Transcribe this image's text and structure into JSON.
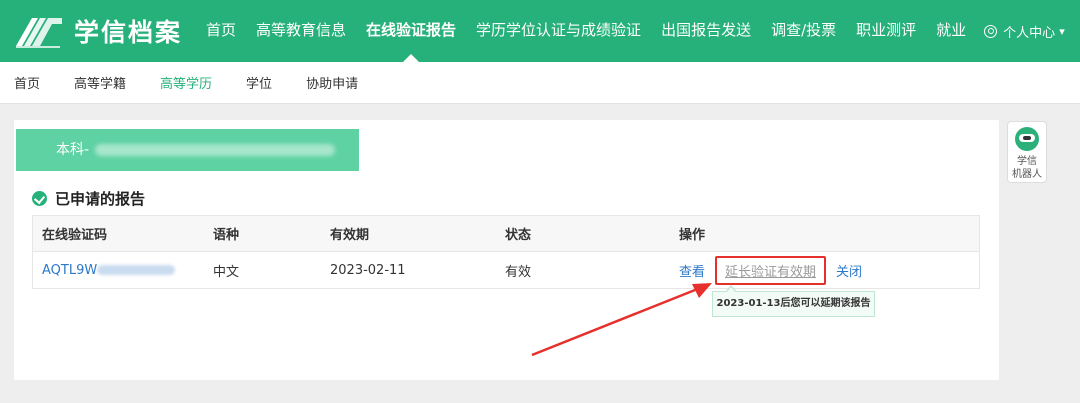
{
  "brand": {
    "name": "学信档案"
  },
  "nav": {
    "items": [
      {
        "label": "首页",
        "active": false
      },
      {
        "label": "高等教育信息",
        "active": false
      },
      {
        "label": "在线验证报告",
        "active": true
      },
      {
        "label": "学历学位认证与成绩验证",
        "active": false
      },
      {
        "label": "出国报告发送",
        "active": false
      },
      {
        "label": "调查/投票",
        "active": false
      },
      {
        "label": "职业测评",
        "active": false
      },
      {
        "label": "就业",
        "active": false
      }
    ],
    "user_center": "个人中心",
    "user_caret": "▾"
  },
  "subnav": {
    "items": [
      {
        "label": "首页",
        "active": false
      },
      {
        "label": "高等学籍",
        "active": false
      },
      {
        "label": "高等学历",
        "active": true
      },
      {
        "label": "学位",
        "active": false
      },
      {
        "label": "协助申请",
        "active": false
      }
    ]
  },
  "degree": {
    "label": "本科-"
  },
  "section": {
    "title": "已申请的报告"
  },
  "table": {
    "headers": [
      "在线验证码",
      "语种",
      "有效期",
      "状态",
      "操作"
    ],
    "rows": [
      {
        "code_prefix": "AQTL9W",
        "language": "中文",
        "expiry": "2023-02-11",
        "status": "有效",
        "view": "查看",
        "extend": "延长验证有效期",
        "close": "关闭"
      }
    ]
  },
  "tooltip": {
    "text": "2023-01-13后您可以延期该报告"
  },
  "robot": {
    "line1": "学信",
    "line2": "机器人"
  },
  "colors": {
    "brand_green": "#26b07a",
    "link_blue": "#2d78c8",
    "highlight_red": "#e5302c"
  }
}
